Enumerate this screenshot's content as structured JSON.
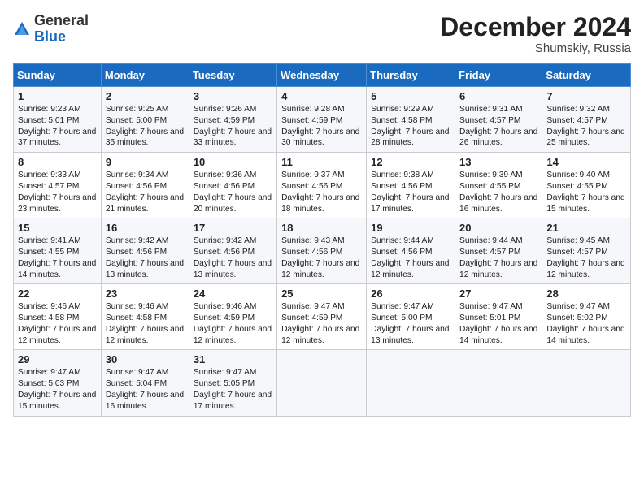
{
  "logo": {
    "general": "General",
    "blue": "Blue"
  },
  "header": {
    "month": "December 2024",
    "location": "Shumskiy, Russia"
  },
  "days_of_week": [
    "Sunday",
    "Monday",
    "Tuesday",
    "Wednesday",
    "Thursday",
    "Friday",
    "Saturday"
  ],
  "weeks": [
    [
      {
        "day": "1",
        "sunrise": "9:23 AM",
        "sunset": "5:01 PM",
        "daylight": "7 hours and 37 minutes."
      },
      {
        "day": "2",
        "sunrise": "9:25 AM",
        "sunset": "5:00 PM",
        "daylight": "7 hours and 35 minutes."
      },
      {
        "day": "3",
        "sunrise": "9:26 AM",
        "sunset": "4:59 PM",
        "daylight": "7 hours and 33 minutes."
      },
      {
        "day": "4",
        "sunrise": "9:28 AM",
        "sunset": "4:59 PM",
        "daylight": "7 hours and 30 minutes."
      },
      {
        "day": "5",
        "sunrise": "9:29 AM",
        "sunset": "4:58 PM",
        "daylight": "7 hours and 28 minutes."
      },
      {
        "day": "6",
        "sunrise": "9:31 AM",
        "sunset": "4:57 PM",
        "daylight": "7 hours and 26 minutes."
      },
      {
        "day": "7",
        "sunrise": "9:32 AM",
        "sunset": "4:57 PM",
        "daylight": "7 hours and 25 minutes."
      }
    ],
    [
      {
        "day": "8",
        "sunrise": "9:33 AM",
        "sunset": "4:57 PM",
        "daylight": "7 hours and 23 minutes."
      },
      {
        "day": "9",
        "sunrise": "9:34 AM",
        "sunset": "4:56 PM",
        "daylight": "7 hours and 21 minutes."
      },
      {
        "day": "10",
        "sunrise": "9:36 AM",
        "sunset": "4:56 PM",
        "daylight": "7 hours and 20 minutes."
      },
      {
        "day": "11",
        "sunrise": "9:37 AM",
        "sunset": "4:56 PM",
        "daylight": "7 hours and 18 minutes."
      },
      {
        "day": "12",
        "sunrise": "9:38 AM",
        "sunset": "4:56 PM",
        "daylight": "7 hours and 17 minutes."
      },
      {
        "day": "13",
        "sunrise": "9:39 AM",
        "sunset": "4:55 PM",
        "daylight": "7 hours and 16 minutes."
      },
      {
        "day": "14",
        "sunrise": "9:40 AM",
        "sunset": "4:55 PM",
        "daylight": "7 hours and 15 minutes."
      }
    ],
    [
      {
        "day": "15",
        "sunrise": "9:41 AM",
        "sunset": "4:55 PM",
        "daylight": "7 hours and 14 minutes."
      },
      {
        "day": "16",
        "sunrise": "9:42 AM",
        "sunset": "4:56 PM",
        "daylight": "7 hours and 13 minutes."
      },
      {
        "day": "17",
        "sunrise": "9:42 AM",
        "sunset": "4:56 PM",
        "daylight": "7 hours and 13 minutes."
      },
      {
        "day": "18",
        "sunrise": "9:43 AM",
        "sunset": "4:56 PM",
        "daylight": "7 hours and 12 minutes."
      },
      {
        "day": "19",
        "sunrise": "9:44 AM",
        "sunset": "4:56 PM",
        "daylight": "7 hours and 12 minutes."
      },
      {
        "day": "20",
        "sunrise": "9:44 AM",
        "sunset": "4:57 PM",
        "daylight": "7 hours and 12 minutes."
      },
      {
        "day": "21",
        "sunrise": "9:45 AM",
        "sunset": "4:57 PM",
        "daylight": "7 hours and 12 minutes."
      }
    ],
    [
      {
        "day": "22",
        "sunrise": "9:46 AM",
        "sunset": "4:58 PM",
        "daylight": "7 hours and 12 minutes."
      },
      {
        "day": "23",
        "sunrise": "9:46 AM",
        "sunset": "4:58 PM",
        "daylight": "7 hours and 12 minutes."
      },
      {
        "day": "24",
        "sunrise": "9:46 AM",
        "sunset": "4:59 PM",
        "daylight": "7 hours and 12 minutes."
      },
      {
        "day": "25",
        "sunrise": "9:47 AM",
        "sunset": "4:59 PM",
        "daylight": "7 hours and 12 minutes."
      },
      {
        "day": "26",
        "sunrise": "9:47 AM",
        "sunset": "5:00 PM",
        "daylight": "7 hours and 13 minutes."
      },
      {
        "day": "27",
        "sunrise": "9:47 AM",
        "sunset": "5:01 PM",
        "daylight": "7 hours and 14 minutes."
      },
      {
        "day": "28",
        "sunrise": "9:47 AM",
        "sunset": "5:02 PM",
        "daylight": "7 hours and 14 minutes."
      }
    ],
    [
      {
        "day": "29",
        "sunrise": "9:47 AM",
        "sunset": "5:03 PM",
        "daylight": "7 hours and 15 minutes."
      },
      {
        "day": "30",
        "sunrise": "9:47 AM",
        "sunset": "5:04 PM",
        "daylight": "7 hours and 16 minutes."
      },
      {
        "day": "31",
        "sunrise": "9:47 AM",
        "sunset": "5:05 PM",
        "daylight": "7 hours and 17 minutes."
      },
      null,
      null,
      null,
      null
    ]
  ]
}
